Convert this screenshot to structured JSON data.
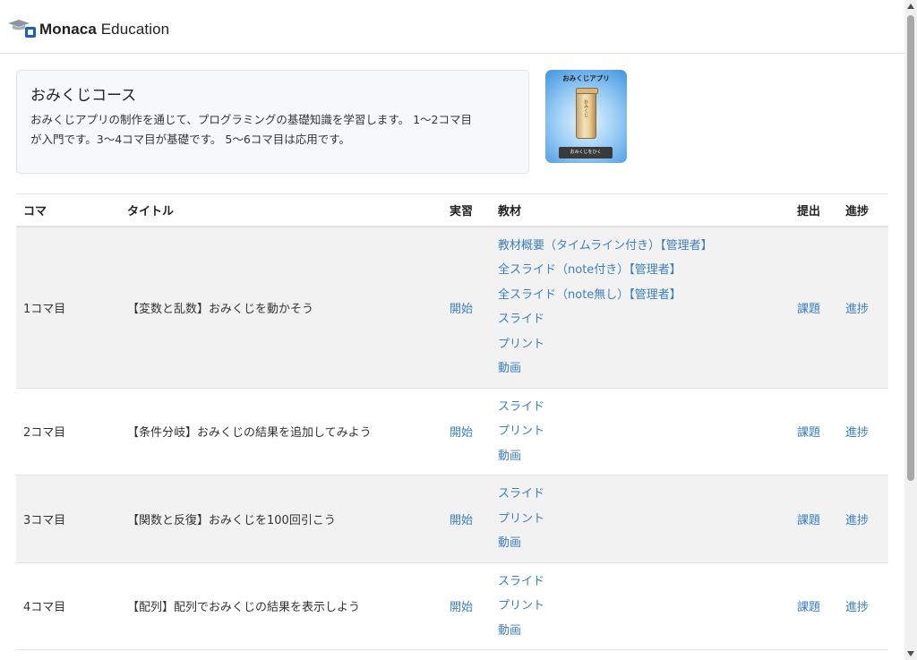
{
  "header": {
    "logo_text_bold": "Monaca",
    "logo_text_rest": " Education"
  },
  "course": {
    "title": "おみくじコース",
    "description_line1": "おみくじアプリの制作を通じて、プログラミングの基礎知識を学習します。 1〜2コマ目",
    "description_line2": "が入門です。3〜4コマ目が基礎です。 5〜6コマ目は応用です。",
    "thumbnail": {
      "title": "おみくじアプリ",
      "tube_label": "おみくじ",
      "button_label": "おみくじをひく"
    }
  },
  "table": {
    "headers": {
      "koma": "コマ",
      "title": "タイトル",
      "jissyu": "実習",
      "kyozai": "教材",
      "teishutsu": "提出",
      "shinchoku": "進捗"
    },
    "rows": [
      {
        "koma": "1コマ目",
        "title": "【変数と乱数】おみくじを動かそう",
        "start": "開始",
        "materials": [
          "教材概要（タイムライン付き）【管理者】",
          "全スライド（note付き）【管理者】",
          "全スライド（note無し）【管理者】",
          "スライド",
          "プリント",
          "動画"
        ],
        "assignment": "課題",
        "progress": "進捗"
      },
      {
        "koma": "2コマ目",
        "title": "【条件分岐】おみくじの結果を追加してみよう",
        "start": "開始",
        "materials": [
          "スライド",
          "プリント",
          "動画"
        ],
        "assignment": "課題",
        "progress": "進捗"
      },
      {
        "koma": "3コマ目",
        "title": "【関数と反復】おみくじを100回引こう",
        "start": "開始",
        "materials": [
          "スライド",
          "プリント",
          "動画"
        ],
        "assignment": "課題",
        "progress": "進捗"
      },
      {
        "koma": "4コマ目",
        "title": "【配列】配列でおみくじの結果を表示しよう",
        "start": "開始",
        "materials": [
          "スライド",
          "プリント",
          "動画"
        ],
        "assignment": "課題",
        "progress": "進捗"
      }
    ]
  },
  "colors": {
    "link": "#3c7fc0",
    "brand": "#1f5fb5",
    "stripe": "#f2f2f2"
  }
}
